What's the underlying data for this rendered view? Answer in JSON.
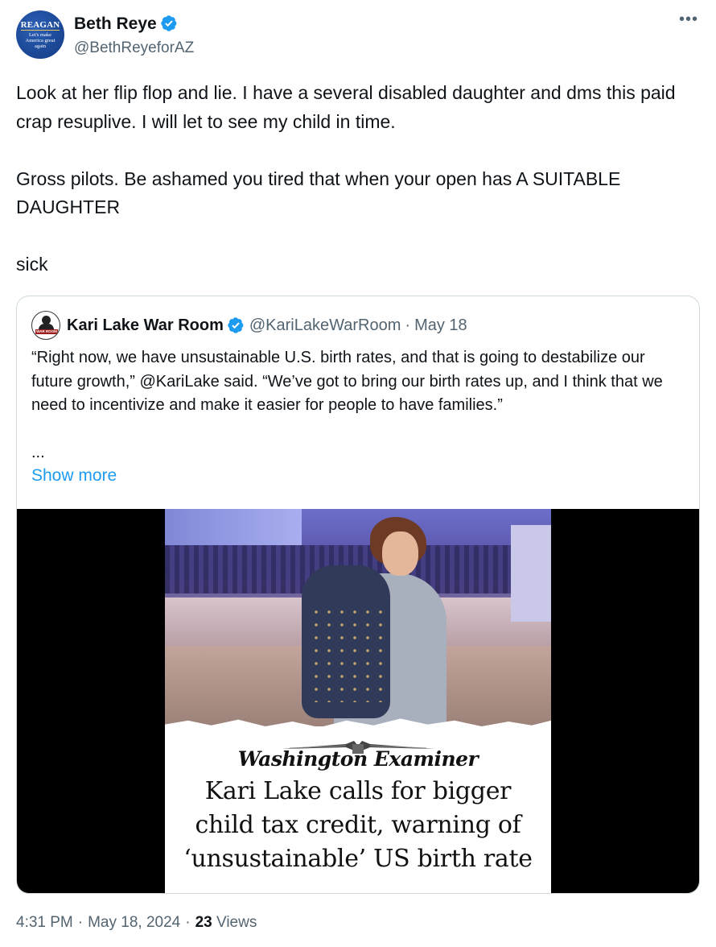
{
  "author": {
    "display_name": "Beth Reye",
    "handle": "@BethReyeforAZ",
    "avatar_text": {
      "brand": "REAGAN",
      "slogan": "Let's make America great again"
    }
  },
  "tweet": {
    "paragraphs": [
      "Look at her flip flop and lie. I have a several disabled daughter and dms this paid crap resuplive. I will let to see my child in time.",
      "Gross pilots. Be ashamed you tired that when your open has A SUITABLE DAUGHTER",
      "sick"
    ]
  },
  "quoted_tweet": {
    "avatar_label": "WAR ROOM",
    "display_name": "Kari Lake War Room",
    "handle": "@KariLakeWarRoom",
    "separator": "·",
    "date": "May 18",
    "text": "“Right now, we have unsustainable U.S. birth rates, and that is going to destabilize our future growth,” @KariLake said. “We’ve got to bring our birth rates up, and I think that we need to incentivize and make it easier for people to have families.”",
    "ellipsis": "...",
    "show_more_label": "Show more",
    "media": {
      "publication": "Washington Examiner",
      "headline_lines": [
        "Kari Lake calls for bigger",
        "child tax credit, warning of",
        "‘unsustainable’ US birth rate"
      ]
    }
  },
  "meta": {
    "time": "4:31 PM",
    "separator": "·",
    "date": "May 18, 2024",
    "views_count": "23",
    "views_label": "Views"
  },
  "colors": {
    "text_primary": "#0f1419",
    "text_secondary": "#536471",
    "link": "#1d9bf0",
    "verified_badge": "#1d9bf0",
    "border": "#cfd9de"
  },
  "icons": {
    "verified": "verified-badge-icon",
    "more": "more-options-icon"
  }
}
